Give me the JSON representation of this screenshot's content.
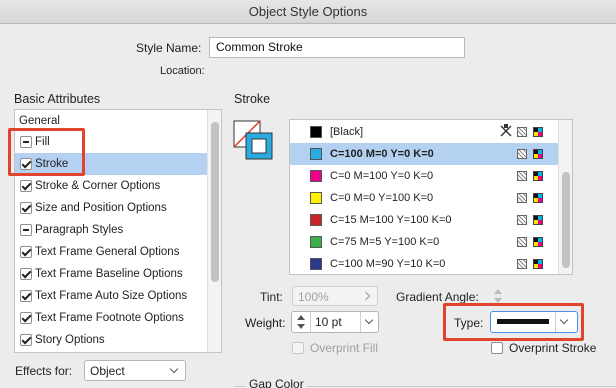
{
  "window": {
    "title": "Object Style Options"
  },
  "header": {
    "style_name_label": "Style Name:",
    "style_name_value": "Common Stroke",
    "location_label": "Location:"
  },
  "basic_attributes": {
    "heading": "Basic Attributes",
    "general_label": "General",
    "items": [
      {
        "label": "Fill",
        "state": "mixed"
      },
      {
        "label": "Stroke",
        "state": "checked",
        "selected": true
      },
      {
        "label": "Stroke & Corner Options",
        "state": "checked"
      },
      {
        "label": "Size and Position Options",
        "state": "checked"
      },
      {
        "label": "Paragraph Styles",
        "state": "mixed"
      },
      {
        "label": "Text Frame General Options",
        "state": "checked"
      },
      {
        "label": "Text Frame Baseline Options",
        "state": "checked"
      },
      {
        "label": "Text Frame Auto Size Options",
        "state": "checked"
      },
      {
        "label": "Text Frame Footnote Options",
        "state": "checked"
      },
      {
        "label": "Story Options",
        "state": "checked"
      }
    ]
  },
  "effects": {
    "label": "Effects for:",
    "value": "Object"
  },
  "stroke": {
    "heading": "Stroke",
    "swatches": [
      {
        "name": "[Black]",
        "color": "#000000",
        "icons": "x-grid-cmyk"
      },
      {
        "name": "C=100 M=0 Y=0 K=0",
        "color": "#29abe2",
        "selected": true
      },
      {
        "name": "C=0 M=100 Y=0 K=0",
        "color": "#ec008c"
      },
      {
        "name": "C=0 M=0 Y=100 K=0",
        "color": "#fff200"
      },
      {
        "name": "C=15 M=100 Y=100 K=0",
        "color": "#cc2229"
      },
      {
        "name": "C=75 M=5 Y=100 K=0",
        "color": "#3eae49"
      },
      {
        "name": "C=100 M=90 Y=10 K=0",
        "color": "#2a3b8f"
      }
    ],
    "tint_label": "Tint:",
    "tint_value": "100%",
    "gradient_angle_label": "Gradient Angle:",
    "weight_label": "Weight:",
    "weight_value": "10 pt",
    "type_label": "Type:",
    "overprint_fill_label": "Overprint Fill",
    "overprint_stroke_label": "Overprint Stroke",
    "gap_color_label": "Gap Color"
  },
  "colors": {
    "selection": "#b5d1f2",
    "highlight": "#e0432e"
  }
}
